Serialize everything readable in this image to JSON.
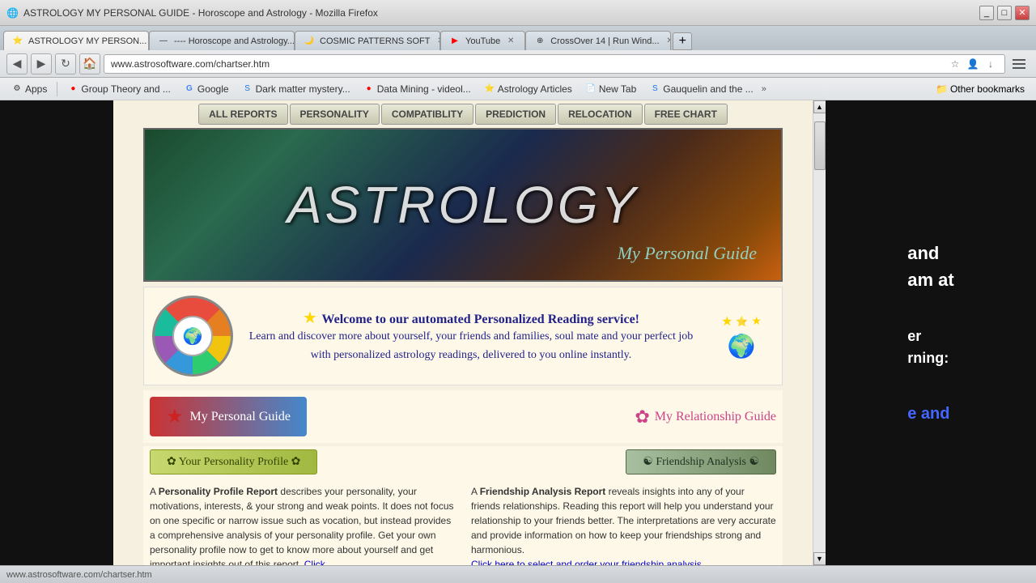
{
  "browser": {
    "tabs": [
      {
        "id": "tab1",
        "label": "ASTROLOGY MY PERSON...",
        "favicon": "⭐",
        "active": true
      },
      {
        "id": "tab2",
        "label": "---- Horoscope and Astrology...",
        "favicon": "—",
        "active": false
      },
      {
        "id": "tab3",
        "label": "COSMIC PATTERNS SOFT",
        "favicon": "🌙",
        "active": false
      },
      {
        "id": "tab4",
        "label": "YouTube",
        "favicon": "▶",
        "active": false
      },
      {
        "id": "tab5",
        "label": "CrossOver 14 | Run Wind...",
        "favicon": "⊕",
        "active": false
      }
    ],
    "address": "www.astrosoftware.com/chartser.htm",
    "status": "www.astrosoftware.com/chartser.htm"
  },
  "bookmarks": [
    {
      "label": "Apps",
      "favicon": "⚙"
    },
    {
      "label": "Group Theory and ...",
      "favicon": "🔴"
    },
    {
      "label": "Google",
      "favicon": "G"
    },
    {
      "label": "Dark matter mystery...",
      "favicon": "S"
    },
    {
      "label": "Data Mining - videol...",
      "favicon": "🔴"
    },
    {
      "label": "Astrology Articles",
      "favicon": "⭐"
    },
    {
      "label": "New Tab",
      "favicon": "📄"
    },
    {
      "label": "Gauquelin and the ...",
      "favicon": "S"
    },
    {
      "label": "Other bookmarks",
      "favicon": "📁"
    }
  ],
  "site": {
    "nav": [
      {
        "label": "ALL REPORTS"
      },
      {
        "label": "PERSONALITY"
      },
      {
        "label": "COMPATIBLITY"
      },
      {
        "label": "PREDICTION"
      },
      {
        "label": "RELOCATION"
      },
      {
        "label": "FREE CHART"
      }
    ],
    "banner": {
      "title": "ASTROLOGY",
      "subtitle": "My Personal Guide"
    },
    "welcome": {
      "heading": "Welcome to our automated Personalized Reading service!",
      "body": "Learn and discover more about yourself, your friends and families, soul mate and your perfect job with personalized astrology readings, delivered to you online instantly."
    },
    "guides": {
      "personal_label": "My Personal Guide",
      "relationship_label": "My Relationship Guide"
    },
    "profiles": {
      "personality_label": "✿ Your Personality Profile ✿",
      "friendship_label": "☯ Friendship Analysis ☯"
    },
    "descriptions": {
      "personality": {
        "intro": "A ",
        "highlight": "Personality Profile Report",
        "text": " describes your personality, your motivations, interests, & your strong and weak points. It does not focus on one specific or narrow issue such as vocation, but instead provides a comprehensive analysis of your personality profile. Get your own personality profile now to get to know more about yourself and get important insights out of this report. ",
        "link_text": "Click"
      },
      "friendship": {
        "intro": "A ",
        "highlight": "Friendship Analysis Report",
        "text": " reveals insights into any of your friends relationships. Reading this report will help you understand your relationship to your friends better. The interpretations are very accurate and provide information on how to keep your friendships strong and harmonious.",
        "link_text": "Click here to select and order your friendship analysis."
      }
    }
  },
  "side_panel": {
    "lines": [
      {
        "text": "and",
        "color": "white"
      },
      {
        "text": "am at",
        "color": "white"
      },
      {
        "text": "",
        "color": "white"
      },
      {
        "text": "er",
        "color": "white"
      },
      {
        "text": "rning:",
        "color": "white"
      },
      {
        "text": "",
        "color": "white"
      },
      {
        "text": "e and",
        "color": "blue"
      }
    ]
  }
}
